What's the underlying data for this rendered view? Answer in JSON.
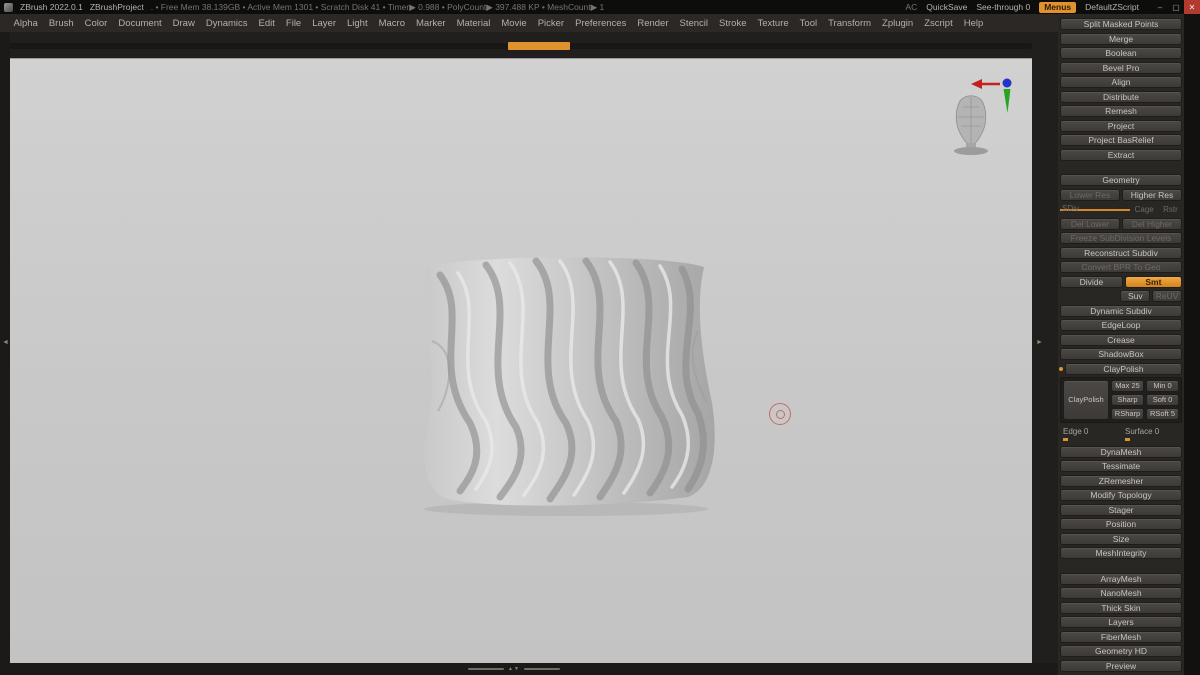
{
  "colors": {
    "accent": "#e0922f",
    "close_red": "#b23b2e",
    "canvas_bg": "#c9c9c9"
  },
  "icons": {
    "minimize": "–",
    "maximize": "▢",
    "close": "✕",
    "tray_left": "◄",
    "tray_right": "►",
    "scroll_arrows": "▲▼"
  },
  "title_bar": {
    "app": "ZBrush 2022.0.1",
    "project": "ZBrushProject",
    "stats": ". • Free Mem 38.139GB • Active Mem 1301 • Scratch Disk 41 • Timer▶ 0.988 • PolyCount▶ 397.488 KP • MeshCount▶ 1",
    "ac": "AC",
    "quicksave": "QuickSave",
    "see_through": "See-through 0",
    "menus": "Menus",
    "default_zscript": "DefaultZScript"
  },
  "menu_bar": {
    "items": [
      "Alpha",
      "Brush",
      "Color",
      "Document",
      "Draw",
      "Dynamics",
      "Edit",
      "File",
      "Layer",
      "Light",
      "Macro",
      "Marker",
      "Material",
      "Movie",
      "Picker",
      "Preferences",
      "Render",
      "Stencil",
      "Stroke",
      "Texture",
      "Tool",
      "Transform",
      "Zplugin",
      "Zscript",
      "Help"
    ]
  },
  "right_panel": {
    "top_buttons": [
      "Split Masked Points",
      "Merge",
      "Boolean",
      "Bevel Pro",
      "Align",
      "Distribute",
      "Remesh",
      "Project",
      "Project BasRelief",
      "Extract"
    ],
    "geometry": {
      "header": "Geometry",
      "lower_res": "Lower Res",
      "higher_res": "Higher Res",
      "sdiv": "SDiv",
      "cage": "Cage",
      "rstr": "Rstr",
      "del_lower": "Del Lower",
      "del_higher": "Del Higher",
      "freeze": "Freeze SubDivision Levels",
      "reconstruct": "Reconstruct Subdiv",
      "convert_bpr": "Convert BPR To Geo",
      "divide": "Divide",
      "smt": "Smt",
      "suv": "Suv",
      "reuv": "ReUV",
      "sections": [
        "Dynamic Subdiv",
        "EdgeLoop",
        "Crease",
        "ShadowBox"
      ],
      "claypolish_header": "ClayPolish",
      "claypolish_button": "ClayPolish",
      "cp_max": "Max 25",
      "cp_min": "Min 0",
      "cp_sharp": "Sharp",
      "cp_soft": "Soft 0",
      "cp_rsharp": "RSharp",
      "cp_rsoft": "RSoft 5",
      "edge": "Edge 0",
      "surface": "Surface 0",
      "sections2": [
        "DynaMesh",
        "Tessimate",
        "ZRemesher",
        "Modify Topology",
        "Stager",
        "Position",
        "Size",
        "MeshIntegrity"
      ]
    },
    "bottom_buttons": [
      "ArrayMesh",
      "NanoMesh",
      "Thick Skin",
      "Layers",
      "FiberMesh",
      "Geometry HD",
      "Preview"
    ]
  }
}
